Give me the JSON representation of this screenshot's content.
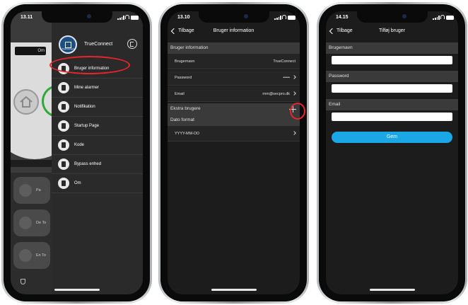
{
  "phone1": {
    "time": "13.11",
    "bg_button": "Om",
    "bg_tiles": [
      "Pa",
      "De To",
      "En To"
    ],
    "menu": {
      "title": "TrueConnect",
      "logo_text": "TrueConnect",
      "items": [
        {
          "label": "Bruger information",
          "icon": "user-icon"
        },
        {
          "label": "Mine alarmer",
          "icon": "list-icon"
        },
        {
          "label": "Notifikation",
          "icon": "bell-icon"
        },
        {
          "label": "Startup Page",
          "icon": "star-icon"
        },
        {
          "label": "Kode",
          "icon": "keypad-icon"
        },
        {
          "label": "Bypass enhed",
          "icon": "bypass-icon"
        },
        {
          "label": "Om",
          "icon": "info-icon"
        }
      ]
    }
  },
  "phone2": {
    "time": "13.10",
    "back": "Tilbage",
    "title": "Bruger information",
    "section_user": "Bruger information",
    "rows": [
      {
        "label": "Brugernavn",
        "value": "TrueConnect"
      },
      {
        "label": "Password",
        "value": "•••••"
      },
      {
        "label": "Email",
        "value": "mm@secpro.dk"
      }
    ],
    "section_extra": "Ekstra brugere",
    "section_date": "Dato format",
    "date_value": "YYYY-MM-DD"
  },
  "phone3": {
    "time": "14.15",
    "back": "Tilbage",
    "title": "Tilføj bruger",
    "label_user": "Brugernavn",
    "label_password": "Password",
    "label_email": "Email",
    "save": "Gem"
  },
  "colors": {
    "accent": "#1ba6e6",
    "highlight": "#e6262b",
    "background": "#1c1c1d"
  }
}
